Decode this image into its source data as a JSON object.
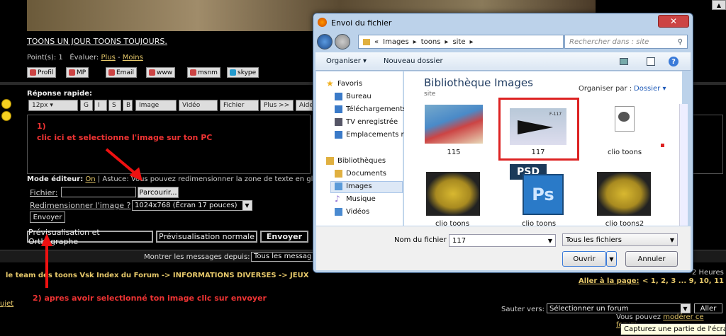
{
  "forum": {
    "title": "TOONS UN JOUR TOONS TOUJOURS.",
    "points_label": "Point(s): 1",
    "evaluer_label": "Évaluer:",
    "plus": "Plus",
    "dash": "-",
    "moins": "Moins",
    "profile_buttons": [
      "Profil",
      "MP",
      "Email",
      "www",
      "msnm",
      "skype"
    ],
    "reponse_rapide": "Réponse rapide:",
    "toolbar": [
      "12px ▾",
      "G",
      "I",
      "S",
      "B",
      "Image",
      "Vidéo",
      "Fichier",
      "Plus >>",
      "Aide"
    ],
    "mode_label": "Mode éditeur:",
    "mode_on": "On",
    "mode_text": "| Astuce: Vous pouvez redimensionner la zone de texte en gliss",
    "fichier_label": "Fichier:",
    "parcourir": "Parcourir...",
    "redim_label": "Redimensionner l'image ?",
    "redim_value": "1024x768 (Écran 17 pouces)",
    "envoyer_small": "Envoyer",
    "btn_preview_ortho": "Prévisualisation et Orthographe",
    "btn_preview": "Prévisualisation normale",
    "btn_envoyer": "Envoyer",
    "montrer_label": "Montrer les messages depuis:",
    "montrer_value": "Tous les messag",
    "breadcrumb": "le team des toons Vsk Index du Forum -> INFORMATIONS DIVERSES -> JEUX",
    "heures": "2 Heures",
    "aller_page": "Aller à la page:",
    "pages": "<  1, 2, 3 ... 9, 10, 11",
    "sujet": "ujet",
    "sauter_label": "Sauter vers:",
    "sauter_value": "Sélectionner un forum",
    "aller": "Aller",
    "vous_pouvez": "Vous pouvez",
    "moderer": "modérer ce forum",
    "tooltip": "Capturez une partie de l'écran p"
  },
  "annotations": {
    "note1_line1": "1)",
    "note1_line2": "clic ici et selectionne l'image sur ton PC",
    "note2": "2) apres avoir selectionné ton image clic sur envoyer"
  },
  "dialog": {
    "title": "Envoi du fichier",
    "close": "✕",
    "address_parts": [
      "«",
      "Images",
      "▸",
      "toons",
      "▸",
      "site",
      "▸"
    ],
    "search_placeholder": "Rechercher dans : site",
    "organiser": "Organiser ▾",
    "nouveau_dossier": "Nouveau dossier",
    "nav_items": [
      {
        "label": "Favoris",
        "color": "#f0b020"
      },
      {
        "label": "Bureau",
        "color": "#3a7ac8"
      },
      {
        "label": "Téléchargements",
        "color": "#3a7ac8"
      },
      {
        "label": "TV enregistrée",
        "color": "#556"
      },
      {
        "label": "Emplacements ré",
        "color": "#3a7ac8"
      },
      {
        "label": "Bibliothèques",
        "color": "#e0b040"
      },
      {
        "label": "Documents",
        "color": "#e0b040"
      },
      {
        "label": "Images",
        "color": "#5a9ad8"
      },
      {
        "label": "Musique",
        "color": "#8a6ad0"
      },
      {
        "label": "Vidéos",
        "color": "#4a8ad0"
      }
    ],
    "library_title": "Bibliothèque Images",
    "library_sub": "site",
    "organiser_par": "Organiser par :",
    "dossier": "Dossier ▾",
    "files": [
      "115",
      "117",
      "clio toons",
      "clio toons",
      "clio toons",
      "clio toons2"
    ],
    "nom_label": "Nom du fichier :",
    "nom_value": "117",
    "filter_value": "Tous les fichiers",
    "ouvrir": "Ouvrir",
    "annuler": "Annuler",
    "psd": "PSD",
    "ps": "Ps",
    "f117": "F-117"
  }
}
